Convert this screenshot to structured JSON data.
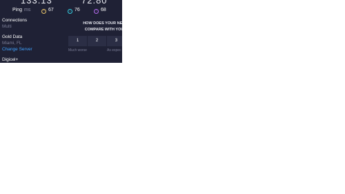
{
  "speeds": {
    "download_value": "133.13",
    "upload_value": "72.80"
  },
  "ping": {
    "label": "Ping",
    "unit": "ms",
    "jitter_value": "67",
    "download_latency": "76",
    "upload_latency": "68"
  },
  "connections": {
    "label": "Connections",
    "value": "Multi"
  },
  "server": {
    "name": "Gold Data",
    "location": "Miami, FL",
    "change_label": "Change Server"
  },
  "isp": {
    "name": "Digicel+"
  },
  "survey": {
    "question_line1": "HOW DOES YOUR NETW",
    "question_line2": "COMPARE WITH YOUR",
    "ratings": [
      "1",
      "2",
      "3"
    ],
    "scale_low": "Much worse",
    "scale_mid": "As expec"
  },
  "colors": {
    "panel_bg": "#1f2135",
    "link": "#3fa3ff",
    "jitter": "#e8c46a",
    "download": "#35d0e3",
    "upload": "#b66cf0"
  }
}
